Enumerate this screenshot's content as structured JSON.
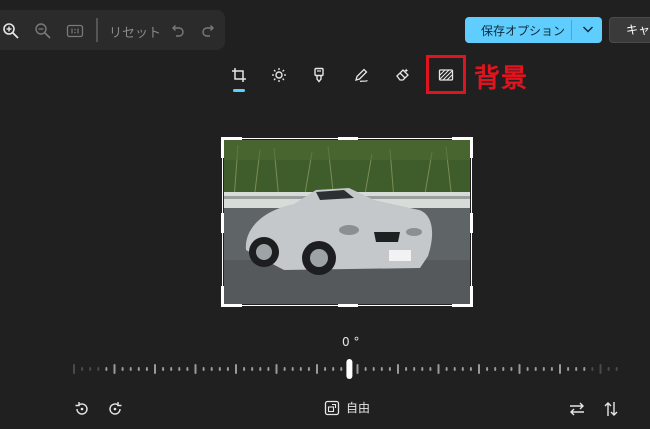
{
  "toolbar": {
    "reset_label": "リセット"
  },
  "header": {
    "save_label": "保存オプション",
    "cancel_label": "キャンセル"
  },
  "annotation": {
    "label": "背景",
    "color": "#e0141e"
  },
  "tools": [
    {
      "name": "crop",
      "active": true
    },
    {
      "name": "adjust"
    },
    {
      "name": "filter"
    },
    {
      "name": "markup"
    },
    {
      "name": "erase"
    },
    {
      "name": "background"
    }
  ],
  "crop": {
    "angle_label": "0 °",
    "aspect_label": "自由"
  },
  "colors": {
    "accent": "#60cdff",
    "background": "#202020"
  }
}
